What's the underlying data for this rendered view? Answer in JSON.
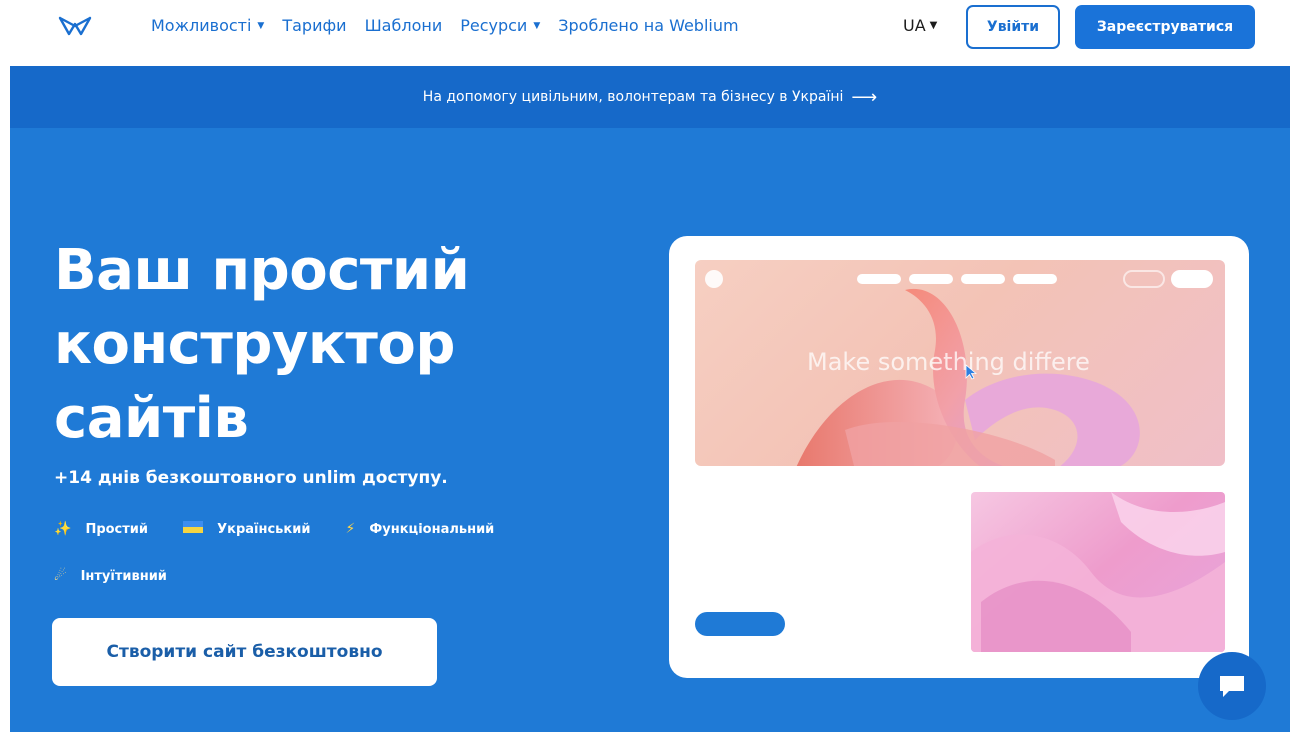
{
  "nav": {
    "menu": [
      {
        "label": "Можливості",
        "has_dropdown": true
      },
      {
        "label": "Тарифи",
        "has_dropdown": false
      },
      {
        "label": "Шаблони",
        "has_dropdown": false
      },
      {
        "label": "Ресурси",
        "has_dropdown": true
      },
      {
        "label": "Зроблено на Weblium",
        "has_dropdown": false
      }
    ],
    "language": "UA",
    "login_label": "Увійти",
    "signup_label": "Зареєструватися"
  },
  "banner": {
    "text": "На допомогу цивільним, волонтерам та бізнесу в Україні",
    "arrow": "⟶"
  },
  "hero": {
    "title_line1": "Ваш простий",
    "title_line2": "конструктор",
    "title_line3": "сайтів",
    "subtitle": "+14 днів безкоштовного unlim доступу.",
    "features": [
      {
        "icon": "sparkles-icon",
        "glyph": "✨",
        "label": "Простий"
      },
      {
        "icon": "ukraine-flag-icon",
        "glyph": "▬",
        "label": "Український"
      },
      {
        "icon": "lightning-icon",
        "glyph": "⚡",
        "label": "Функціональний"
      },
      {
        "icon": "comet-icon",
        "glyph": "☄",
        "label": "Інтуїтивний"
      }
    ],
    "cta_label": "Створити сайт безкоштовно"
  },
  "mockup": {
    "heading": "Make something differe"
  },
  "colors": {
    "brand_blue": "#1f7ad6",
    "banner_blue": "#1669c9",
    "link_blue": "#1a6fd0"
  }
}
